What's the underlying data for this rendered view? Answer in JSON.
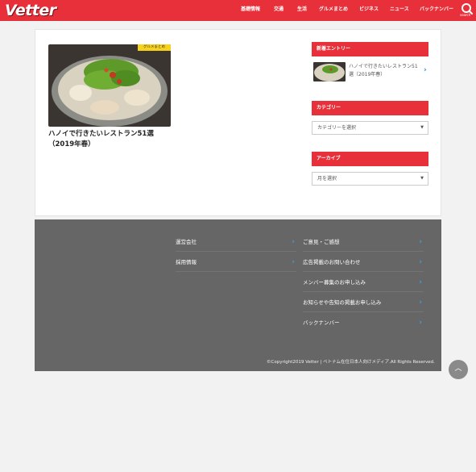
{
  "header": {
    "logo_text": "Vetter",
    "nav": [
      "基礎情報",
      "交通",
      "生活",
      "グルメまとめ",
      "ビジネス",
      "ニュース",
      "バックナンバー"
    ],
    "search_label": "search"
  },
  "main": {
    "post": {
      "tag": "グルメまとめ",
      "title": "ハノイで行きたいレストラン51選（2019年春）"
    }
  },
  "sidebar": {
    "new_entries_title": "新着エントリー",
    "new_entry_title": "ハノイで行きたいレストラン51選（2019年春）",
    "category_title": "カテゴリー",
    "category_select": "カテゴリーを選択",
    "archive_title": "アーカイブ",
    "archive_select": "月を選択"
  },
  "footer": {
    "left_links": [
      "運営会社",
      "採用情報"
    ],
    "right_links": [
      "ご意見・ご感想",
      "広告掲載のお問い合わせ",
      "メンバー募集のお申し込み",
      "お知らせや告知の掲載お申し込み",
      "バックナンバー"
    ],
    "copyright": "©Copyright2019 Vetter | ベトナム在住日本人向けメディア.All Rights Reserved."
  },
  "colors": {
    "brand_red": "#e8303a",
    "footer_gray": "#666666",
    "link_blue": "#3aa3e6"
  }
}
